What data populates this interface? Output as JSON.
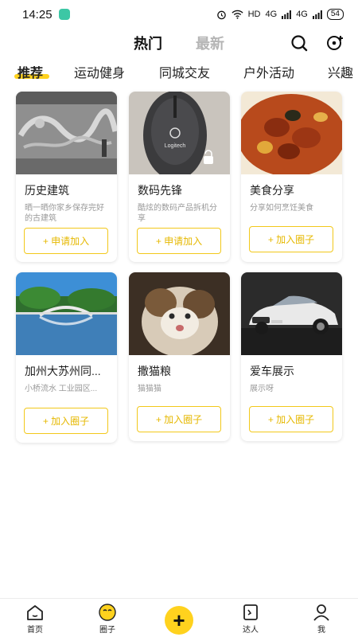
{
  "status_bar": {
    "time": "14:25",
    "network": "HD",
    "signal1": "4G",
    "signal2": "4G",
    "battery": "54"
  },
  "header": {
    "tab_hot": "热门",
    "tab_new": "最新",
    "search_icon": "search-icon",
    "add_icon": "add-circle-icon"
  },
  "categories": [
    "推荐",
    "运动健身",
    "同城交友",
    "户外活动",
    "兴趣"
  ],
  "active_category": "推荐",
  "cards": [
    {
      "title": "历史建筑",
      "desc": "晒一晒你家乡保存完好的古建筑",
      "button": "+ 申请加入"
    },
    {
      "title": "数码先锋",
      "desc": "酷炫的数码产品拆机分享",
      "button": "+ 申请加入"
    },
    {
      "title": "美食分享",
      "desc": "分享如何烹饪美食",
      "button": "+ 加入圈子"
    },
    {
      "title": "加州大苏州同...",
      "desc": "小桥流水 工业园区...",
      "button": "+ 加入圈子"
    },
    {
      "title": "撒猫粮",
      "desc": "猫猫猫",
      "button": "+ 加入圈子"
    },
    {
      "title": "爱车展示",
      "desc": "展示呀",
      "button": "+ 加入圈子"
    }
  ],
  "card_images": [
    "carved-dragon-wall",
    "logitech-mouse",
    "braised-meat-dish",
    "garden-bridge-lake",
    "fluffy-cat",
    "white-sports-car"
  ],
  "mouse_brand": "Logitech",
  "nav": {
    "home": "首页",
    "circle": "圈子",
    "add": "+",
    "talent": "达人",
    "me": "我"
  },
  "colors": {
    "accent": "#ffd21e",
    "button_text": "#e6b800",
    "muted": "#999999"
  }
}
